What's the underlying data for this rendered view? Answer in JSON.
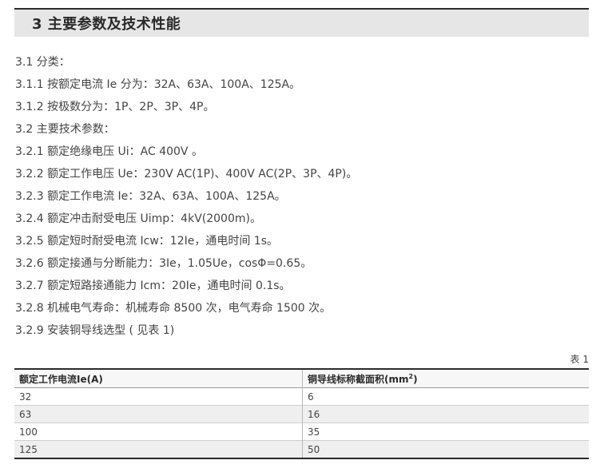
{
  "section": {
    "title": "3 主要参数及技术性能"
  },
  "params": [
    "3.1 分类：",
    "3.1.1 按额定电流 Ie 分为：32A、63A、100A、125A。",
    "3.1.2 按极数分为：1P、2P、3P、4P。",
    "3.2 主要技术参数：",
    "3.2.1 额定绝缘电压 Ui：AC 400V 。",
    "3.2.2 额定工作电压 Ue：230V AC(1P)、400V AC(2P、3P、4P)。",
    "3.2.3 额定工作电流 Ie：32A、63A、100A、125A。",
    "3.2.4 额定冲击耐受电压 Uimp：4kV(2000m)。",
    "3.2.5 额定短时耐受电流 Icw：12Ie，通电时间 1s。",
    "3.2.6 额定接通与分断能力：3Ie，1.05Ue，cosΦ=0.65。",
    "3.2.7 额定短路接通能力 Icm：20Ie，通电时间 0.1s。",
    "3.2.8 机械电气寿命：机械寿命 8500 次，电气寿命 1500 次。",
    "3.2.9 安装铜导线选型 ( 见表 1)"
  ],
  "table": {
    "caption": "表 1",
    "headers": [
      "额定工作电流Ie(A)",
      "铜导线标称截面积(mm",
      "2",
      ")"
    ],
    "rows": [
      [
        "32",
        "6"
      ],
      [
        "63",
        "16"
      ],
      [
        "100",
        "35"
      ],
      [
        "125",
        "50"
      ]
    ]
  }
}
